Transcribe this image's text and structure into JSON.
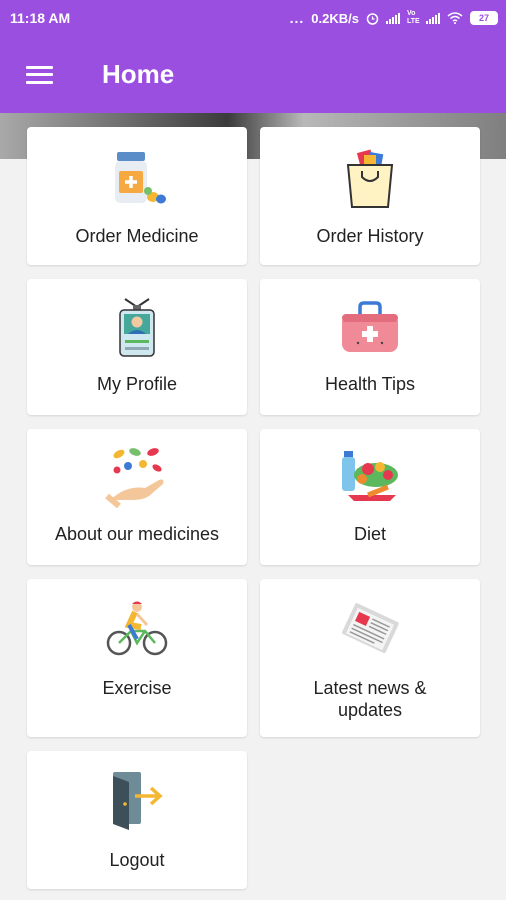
{
  "status_bar": {
    "time": "11:18 AM",
    "dots": "...",
    "network_speed": "0.2KB/s",
    "volte": "Vo LTE",
    "battery": "27"
  },
  "toolbar": {
    "title": "Home",
    "menu_icon": "hamburger-menu-icon"
  },
  "theme": {
    "primary": "#9b4fe0",
    "card_bg": "#ffffff",
    "page_bg": "#f2f2f2"
  },
  "menu": {
    "items": [
      {
        "label": "Order Medicine",
        "icon": "medicine-bottle-icon"
      },
      {
        "label": "Order History",
        "icon": "shopping-bag-icon"
      },
      {
        "label": "My Profile",
        "icon": "id-badge-icon"
      },
      {
        "label": "Health Tips",
        "icon": "first-aid-kit-icon"
      },
      {
        "label": "About our medicines",
        "icon": "hand-pills-icon"
      },
      {
        "label": "Diet",
        "icon": "healthy-food-icon"
      },
      {
        "label": "Exercise",
        "icon": "cyclist-icon"
      },
      {
        "label": "Latest news & updates",
        "icon": "newspaper-icon"
      },
      {
        "label": "Logout",
        "icon": "logout-door-icon"
      }
    ]
  }
}
